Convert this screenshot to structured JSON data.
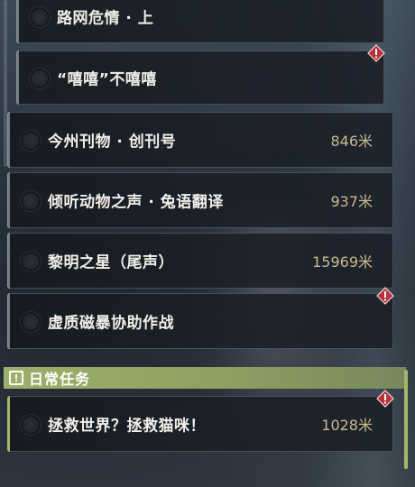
{
  "quests": {
    "items": [
      {
        "title": "路网危情 · 上",
        "distance": "",
        "alert": false
      },
      {
        "title": "“嘻嘻”不嘻嘻",
        "distance": "",
        "alert": true
      },
      {
        "title": "今州刊物 · 创刊号",
        "distance": "846米",
        "alert": false
      },
      {
        "title": "倾听动物之声 · 兔语翻译",
        "distance": "937米",
        "alert": false
      },
      {
        "title": "黎明之星（尾声）",
        "distance": "15969米",
        "alert": false
      },
      {
        "title": "虚质磁暴协助作战",
        "distance": "",
        "alert": true
      }
    ]
  },
  "daily": {
    "header": "日常任务",
    "icon": "exclamation-icon",
    "items": [
      {
        "title": "拯救世界？拯救猫咪！",
        "distance": "1028米",
        "alert": true
      }
    ]
  },
  "colors": {
    "accent_green": "#a3b86a",
    "distance_gold": "#c9b98c",
    "alert_red": "#b8323c"
  }
}
